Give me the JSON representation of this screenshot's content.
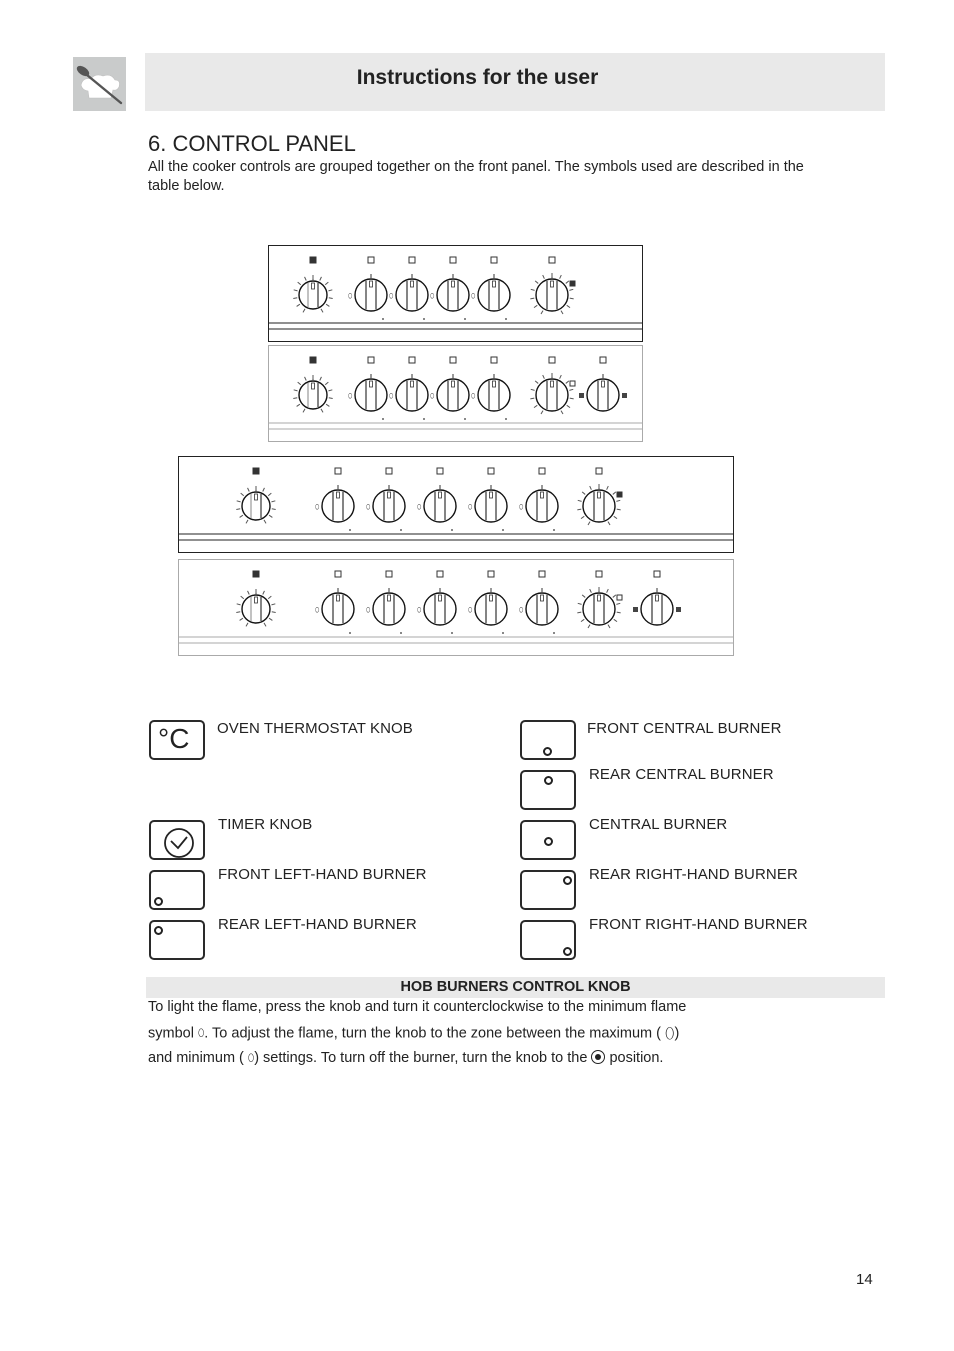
{
  "header": {
    "logo_icon": "spoon-chef-hat-icon",
    "title": "Instructions for the user"
  },
  "section": {
    "title": "6. CONTROL PANEL",
    "intro_line1": "All the cooker controls are grouped together on the front panel. The symbols used are described in the",
    "intro_line2": "table below."
  },
  "panels": [
    {
      "name": "panel-60cm-thermostat-timer",
      "knobs": [
        "thermostat",
        "burner",
        "burner",
        "burner",
        "burner",
        "timer"
      ]
    },
    {
      "name": "panel-60cm-thermostat-timer-extra",
      "knobs": [
        "thermostat",
        "burner",
        "burner",
        "burner",
        "burner",
        "timer",
        "selector"
      ]
    },
    {
      "name": "panel-90cm-thermostat-timer",
      "knobs": [
        "thermostat",
        "burner",
        "burner",
        "burner",
        "burner",
        "burner",
        "timer"
      ]
    },
    {
      "name": "panel-90cm-thermostat-timer-extra",
      "knobs": [
        "thermostat",
        "burner",
        "burner",
        "burner",
        "burner",
        "burner",
        "timer",
        "selector"
      ]
    }
  ],
  "legend": {
    "left": [
      {
        "icon": "celsius-icon",
        "symbol": "°C",
        "label": "OVEN THERMOSTAT KNOB"
      },
      {
        "icon": "clock-icon",
        "label": "TIMER KNOB"
      },
      {
        "icon": "front-left-burner-icon",
        "label": "FRONT LEFT-HAND BURNER"
      },
      {
        "icon": "rear-left-burner-icon",
        "label": "REAR LEFT-HAND BURNER"
      }
    ],
    "right": [
      {
        "icon": "front-central-burner-icon",
        "label": "FRONT CENTRAL BURNER"
      },
      {
        "icon": "rear-central-burner-icon",
        "label": "REAR CENTRAL BURNER"
      },
      {
        "icon": "central-burner-icon",
        "label": "CENTRAL BURNER"
      },
      {
        "icon": "rear-right-burner-icon",
        "label": "REAR RIGHT-HAND BURNER"
      },
      {
        "icon": "front-right-burner-icon",
        "label": "FRONT RIGHT-HAND BURNER"
      }
    ]
  },
  "hob": {
    "title": "HOB BURNERS CONTROL KNOB",
    "line1": "To light the flame, press the knob and turn it counterclockwise to the minimum flame",
    "line2_a": "symbol",
    "line2_b": ". To adjust the flame, turn the knob to the zone between the maximum (",
    "line2_c": ")",
    "line3_a": "and minimum (",
    "line3_b": ") settings. To turn off the burner, turn the knob to the",
    "line3_c": "position.",
    "flame_small": "0",
    "flame_big": "0"
  },
  "page_number": "14"
}
